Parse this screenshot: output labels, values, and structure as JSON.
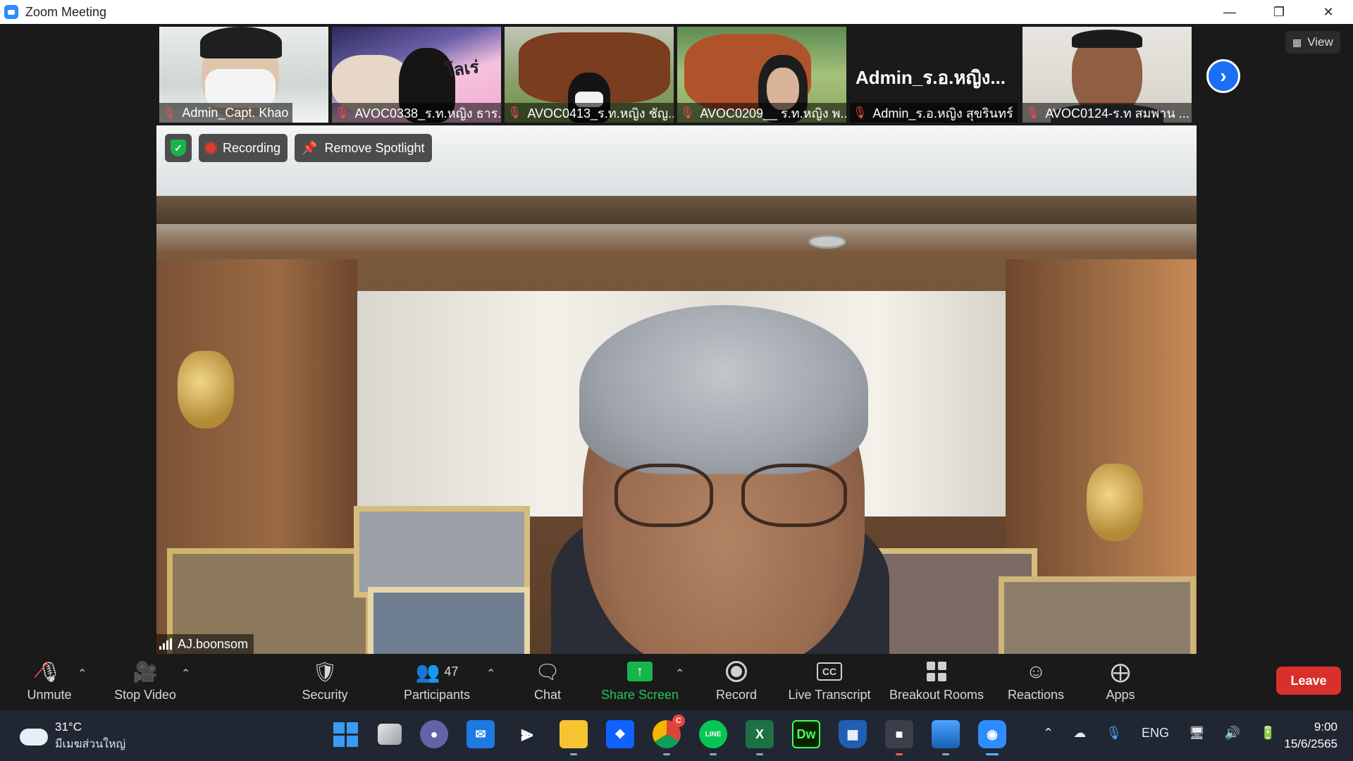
{
  "window": {
    "title": "Zoom Meeting",
    "minimize_icon": "minimize-icon",
    "restore_icon": "restore-icon",
    "close_icon": "close-icon"
  },
  "gallery": {
    "tiles": [
      {
        "name": "Admin_Capt. Khao",
        "muted": true
      },
      {
        "name": "AVOC0338_ร.ท.หญิง ธาร...",
        "muted": true,
        "overlay_text": "โลเร่"
      },
      {
        "name": "AVOC0413_ร.ท.หญิง ชัญ...",
        "muted": true
      },
      {
        "name": "AVOC0209__ ร.ท.หญิง พ...",
        "muted": true
      },
      {
        "name": "Admin_ร.อ.หญิง สุขรินทร์",
        "muted": true,
        "display_text": "Admin_ร.อ.หญิง..."
      },
      {
        "name": "AVOC0124-ร.ท สมพาน ...",
        "muted": true
      }
    ],
    "next_icon": "chevron-right-icon",
    "view_label": "View"
  },
  "spotlight": {
    "speaker_name": "AJ.boonsom",
    "recording_label": "Recording",
    "remove_spotlight_label": "Remove Spotlight"
  },
  "toolbar": {
    "unmute_label": "Unmute",
    "stop_video_label": "Stop Video",
    "security_label": "Security",
    "participants_label": "Participants",
    "participants_count": "47",
    "chat_label": "Chat",
    "share_screen_label": "Share Screen",
    "record_label": "Record",
    "live_transcript_label": "Live Transcript",
    "cc_text": "CC",
    "breakout_rooms_label": "Breakout Rooms",
    "reactions_label": "Reactions",
    "apps_label": "Apps",
    "leave_label": "Leave"
  },
  "taskbar": {
    "weather_temp": "31°C",
    "weather_desc": "มีเมฆส่วนใหญ่",
    "language": "ENG",
    "time": "9:00",
    "date": "15/6/2565",
    "chrome_badge": "C",
    "dw_label": "Dw"
  }
}
